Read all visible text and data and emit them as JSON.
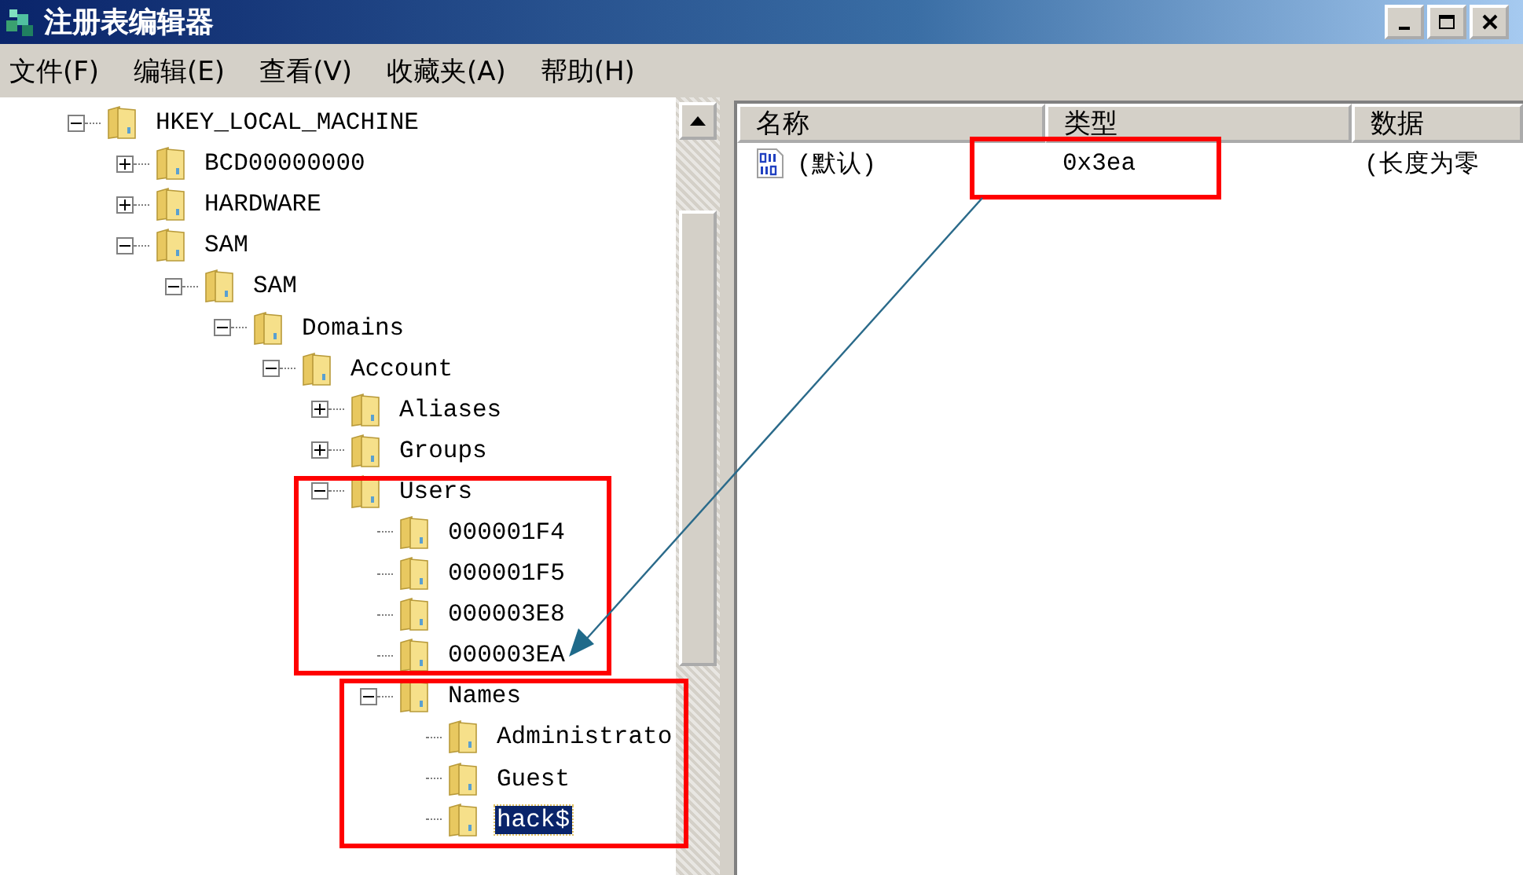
{
  "window": {
    "title": "注册表编辑器"
  },
  "menu": [
    "文件(F)",
    "编辑(E)",
    "查看(V)",
    "收藏夹(A)",
    "帮助(H)"
  ],
  "tree": [
    {
      "label": "HKEY_LOCAL_MACHINE",
      "expanded": true,
      "selected": false,
      "children": [
        {
          "label": "BCD00000000",
          "expanded": false,
          "selected": false
        },
        {
          "label": "HARDWARE",
          "expanded": false,
          "selected": false
        },
        {
          "label": "SAM",
          "expanded": true,
          "selected": false,
          "children": [
            {
              "label": "SAM",
              "expanded": true,
              "selected": false,
              "children": [
                {
                  "label": "Domains",
                  "expanded": true,
                  "selected": false,
                  "children": [
                    {
                      "label": "Account",
                      "expanded": true,
                      "selected": false,
                      "children": [
                        {
                          "label": "Aliases",
                          "expanded": false,
                          "selected": false
                        },
                        {
                          "label": "Groups",
                          "expanded": false,
                          "selected": false
                        },
                        {
                          "label": "Users",
                          "expanded": true,
                          "selected": false,
                          "children": [
                            {
                              "label": "000001F4",
                              "selected": false
                            },
                            {
                              "label": "000001F5",
                              "selected": false
                            },
                            {
                              "label": "000003E8",
                              "selected": false
                            },
                            {
                              "label": "000003EA",
                              "selected": false
                            },
                            {
                              "label": "Names",
                              "expanded": true,
                              "selected": false,
                              "children": [
                                {
                                  "label": "Administrato",
                                  "selected": false
                                },
                                {
                                  "label": "Guest",
                                  "selected": false
                                },
                                {
                                  "label": "hack$",
                                  "selected": true
                                }
                              ]
                            }
                          ]
                        }
                      ]
                    }
                  ]
                }
              ]
            }
          ]
        }
      ]
    }
  ],
  "values": {
    "columns": [
      "名称",
      "类型",
      "数据"
    ],
    "rows": [
      {
        "name": "(默认)",
        "type": "0x3ea",
        "data": "(长度为零"
      }
    ]
  }
}
